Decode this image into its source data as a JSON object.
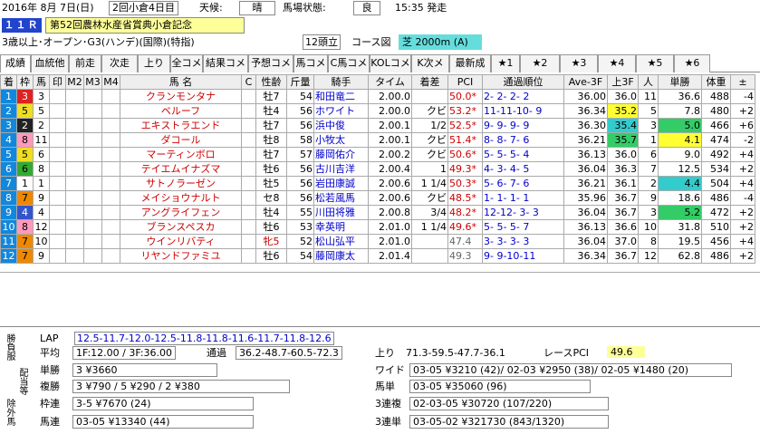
{
  "header": {
    "date": "2016年 8月 7日(日)",
    "kai": "2回小倉4日目",
    "weather_label": "天候:",
    "weather": "晴",
    "track_label": "馬場状態:",
    "track": "良",
    "post_time": "15:35 発走"
  },
  "race": {
    "no": "１１Ｒ",
    "name": "第52回農林水産省賞典小倉記念",
    "conditions": "3歳以上･オープン･G3(ハンデ)(国際)(特指)",
    "heads": "12頭立",
    "course_label": "コース図",
    "course": "芝 2000m (A)"
  },
  "tabs": [
    "成績",
    "血統他",
    "前走",
    "次走",
    "上り",
    "全コメ",
    "結果コメ",
    "予想コメ",
    "馬コメ",
    "C馬コメ",
    "KOLコメ",
    "K次メモ",
    "最新成",
    "★1",
    "★2",
    "★3",
    "★4",
    "★5",
    "★6"
  ],
  "columns": [
    "着",
    "枠",
    "馬",
    "印",
    "M2",
    "M3",
    "M4",
    "馬 名",
    "C",
    "性齢",
    "斤量",
    "騎手",
    "タイム",
    "着差",
    "PCI",
    "通過順位",
    "Ave-3F",
    "上3F",
    "人",
    "単勝",
    "体重",
    "±"
  ],
  "rows": [
    {
      "chaku": "1",
      "waku": "3",
      "uma": "3",
      "name": "クランモンタナ",
      "sei": "牡7",
      "kin": "54",
      "jockey": "和田竜二",
      "time": "2.00.0",
      "sa": "",
      "pci": "50.0*",
      "pos": "2- 2- 2- 2",
      "ave": "36.00",
      "agari": "36.0",
      "ninki": "11",
      "tan": "36.6",
      "wt": "488",
      "pm": "-4"
    },
    {
      "chaku": "2",
      "waku": "5",
      "uma": "5",
      "name": "ベルーフ",
      "sei": "牡4",
      "kin": "56",
      "jockey": "ホワイト",
      "time": "2.00.0",
      "sa": "クビ",
      "pci": "53.2*",
      "pos": "11-11-10- 9",
      "ave": "36.34",
      "agari": "35.2",
      "ninki": "5",
      "tan": "7.8",
      "wt": "480",
      "pm": "+2"
    },
    {
      "chaku": "3",
      "waku": "2",
      "uma": "2",
      "name": "エキストラエンド",
      "sei": "牡7",
      "kin": "56",
      "jockey": "浜中俊",
      "time": "2.00.1",
      "sa": "1/2",
      "pci": "52.5*",
      "pos": "9- 9- 9- 9",
      "ave": "36.30",
      "agari": "35.4",
      "ninki": "3",
      "tan": "5.0",
      "wt": "466",
      "pm": "+6"
    },
    {
      "chaku": "4",
      "waku": "8",
      "uma": "11",
      "name": "ダコール",
      "sei": "牡8",
      "kin": "58",
      "jockey": "小牧太",
      "time": "2.00.1",
      "sa": "クビ",
      "pci": "51.4*",
      "pos": "8- 8- 7- 6",
      "ave": "36.21",
      "agari": "35.7",
      "ninki": "1",
      "tan": "4.1",
      "wt": "474",
      "pm": "-2"
    },
    {
      "chaku": "5",
      "waku": "5",
      "uma": "6",
      "name": "マーティンボロ",
      "sei": "牡7",
      "kin": "57",
      "jockey": "藤岡佑介",
      "time": "2.00.2",
      "sa": "クビ",
      "pci": "50.6*",
      "pos": "5- 5- 5- 4",
      "ave": "36.13",
      "agari": "36.0",
      "ninki": "6",
      "tan": "9.0",
      "wt": "492",
      "pm": "+4"
    },
    {
      "chaku": "6",
      "waku": "6",
      "uma": "8",
      "name": "テイエムイナズマ",
      "sei": "牡6",
      "kin": "56",
      "jockey": "古川吉洋",
      "time": "2.00.4",
      "sa": "1",
      "pci": "49.3*",
      "pos": "4- 3- 4- 5",
      "ave": "36.04",
      "agari": "36.3",
      "ninki": "7",
      "tan": "12.5",
      "wt": "534",
      "pm": "+2"
    },
    {
      "chaku": "7",
      "waku": "1",
      "uma": "1",
      "name": "サトノラーゼン",
      "sei": "牡5",
      "kin": "56",
      "jockey": "岩田康誠",
      "time": "2.00.6",
      "sa": "1 1/4",
      "pci": "50.3*",
      "pos": "5- 6- 7- 6",
      "ave": "36.21",
      "agari": "36.1",
      "ninki": "2",
      "tan": "4.4",
      "wt": "504",
      "pm": "+4"
    },
    {
      "chaku": "8",
      "waku": "7",
      "uma": "9",
      "name": "メイショウナルト",
      "sei": "セ8",
      "kin": "56",
      "jockey": "松若風馬",
      "time": "2.00.6",
      "sa": "クビ",
      "pci": "48.5*",
      "pos": "1- 1- 1- 1",
      "ave": "35.96",
      "agari": "36.7",
      "ninki": "9",
      "tan": "18.6",
      "wt": "486",
      "pm": "-4"
    },
    {
      "chaku": "9",
      "waku": "4",
      "uma": "4",
      "name": "アングライフェン",
      "sei": "牡4",
      "kin": "55",
      "jockey": "川田将雅",
      "time": "2.00.8",
      "sa": "3/4",
      "pci": "48.2*",
      "pos": "12-12- 3- 3",
      "ave": "36.04",
      "agari": "36.7",
      "ninki": "3",
      "tan": "5.2",
      "wt": "472",
      "pm": "+2"
    },
    {
      "chaku": "10",
      "waku": "8",
      "uma": "12",
      "name": "ブランスペスカ",
      "sei": "牡6",
      "kin": "53",
      "jockey": "幸英明",
      "time": "2.01.0",
      "sa": "1 1/4",
      "pci": "49.6*",
      "pos": "5- 5- 5- 7",
      "ave": "36.13",
      "agari": "36.6",
      "ninki": "10",
      "tan": "31.8",
      "wt": "510",
      "pm": "+2"
    },
    {
      "chaku": "11",
      "waku": "7",
      "uma": "10",
      "name": "ウインリバティ",
      "sei": "牝5",
      "kin": "52",
      "jockey": "松山弘平",
      "time": "2.01.0",
      "sa": "",
      "pci": "47.4",
      "pos": "3- 3- 3- 3",
      "ave": "36.04",
      "agari": "37.0",
      "ninki": "8",
      "tan": "19.5",
      "wt": "456",
      "pm": "+4"
    },
    {
      "chaku": "12",
      "waku": "7",
      "uma": "9",
      "name": "リヤンドファミユ",
      "sei": "牡6",
      "kin": "54",
      "jockey": "藤岡康太",
      "time": "2.01.4",
      "sa": "",
      "pci": "49.3",
      "pos": "9- 9-10-11",
      "ave": "36.34",
      "agari": "36.7",
      "ninki": "12",
      "tan": "62.8",
      "wt": "486",
      "pm": "+2"
    }
  ],
  "summary": {
    "lap_label": "LAP",
    "lap": "12.5-11.7-12.0-12.5-11.8-11.8-11.6-11.7-11.8-12.6",
    "avg_label": "平均",
    "avg": "1F:12.00 / 3F:36.00",
    "tsuka_label": "通過",
    "tsuka": "36.2-48.7-60.5-72.3",
    "agari_label": "上り",
    "agari": "71.3-59.5-47.7-36.1",
    "rpci_label": "レースPCI",
    "rpci": "49.6",
    "tansho_label": "単勝",
    "tansho": "3 ¥3660",
    "fukusho_label": "複勝",
    "fukusho": "3 ¥790 / 5 ¥290 / 2 ¥380",
    "wakuren_label": "枠連",
    "wakuren": "3-5 ¥7670 (24)",
    "umaren_label": "馬連",
    "umaren": "03-05 ¥13340 (44)",
    "wide_label": "ワイド",
    "wide": "03-05 ¥3210 (42)/ 02-03 ¥2950 (38)/ 02-05 ¥1480 (20)",
    "umatan_label": "馬単",
    "umatan": "03-05 ¥35060 (96)",
    "sanrenpuku_label": "3連複",
    "sanrenpuku": "02-03-05 ¥30720 (107/220)",
    "sanrentan_label": "3連単",
    "sanrentan": "03-05-02 ¥321730 (843/1320)",
    "side_shobu": "勝負服",
    "side_haito": "配当等",
    "side_jogai": "除外馬"
  },
  "colors": {
    "waku": [
      "#ffffff",
      "#222222",
      "#dd2222",
      "#3355cc",
      "#eedd22",
      "#33aa33",
      "#ee8800",
      "#ff99bb"
    ],
    "rank_num": "#1188dd",
    "agari1": "#ffff33",
    "agari2": "#33cccc",
    "agari3": "#33cc66"
  }
}
